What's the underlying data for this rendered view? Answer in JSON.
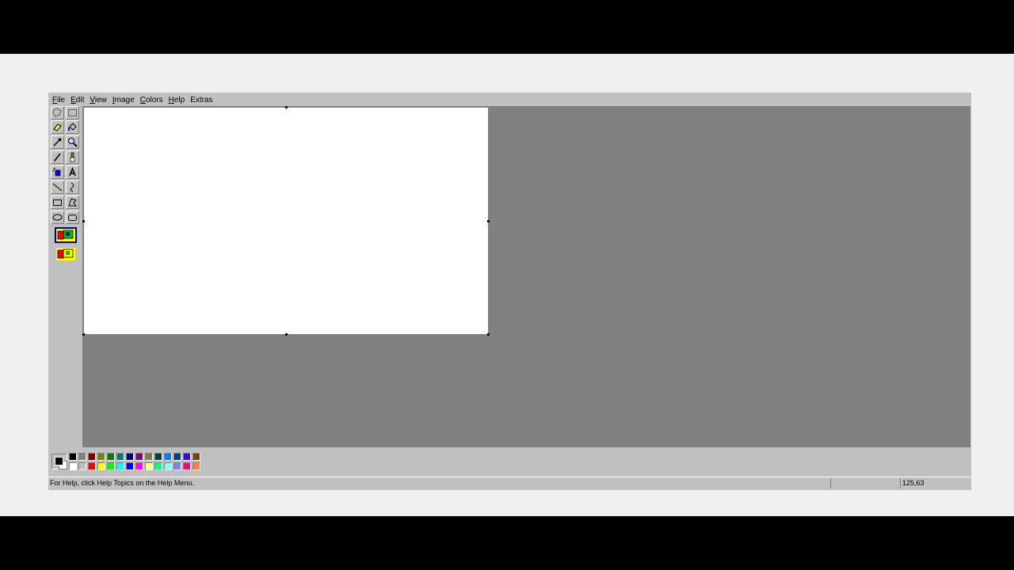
{
  "menu": [
    {
      "label": "File",
      "underline": "F",
      "rest": "ile"
    },
    {
      "label": "Edit",
      "underline": "E",
      "rest": "dit"
    },
    {
      "label": "View",
      "underline": "V",
      "rest": "iew"
    },
    {
      "label": "Image",
      "underline": "I",
      "rest": "mage"
    },
    {
      "label": "Colors",
      "underline": "C",
      "rest": "olors"
    },
    {
      "label": "Help",
      "underline": "H",
      "rest": "elp"
    },
    {
      "label": "Extras",
      "underline": "",
      "rest": "Extras"
    }
  ],
  "tools": [
    "free-select-icon",
    "rect-select-icon",
    "eraser-icon",
    "fill-bucket-icon",
    "color-picker-icon",
    "magnifier-icon",
    "pencil-icon",
    "brush-icon",
    "airbrush-icon",
    "text-icon",
    "line-icon",
    "curve-icon",
    "rectangle-icon",
    "polygon-icon",
    "ellipse-icon",
    "rounded-rect-icon"
  ],
  "palette": {
    "foreground": "#000000",
    "background": "#ffffff",
    "top_row": [
      "#000000",
      "#808080",
      "#800000",
      "#808000",
      "#008000",
      "#008080",
      "#000080",
      "#800080",
      "#808040",
      "#004040",
      "#0080ff",
      "#004080",
      "#4000ff",
      "#804000"
    ],
    "bottom_row": [
      "#ffffff",
      "#c0c0c0",
      "#ff0000",
      "#ffff00",
      "#00ff00",
      "#00ffff",
      "#0000ff",
      "#ff00ff",
      "#ffff80",
      "#00ff80",
      "#80ffff",
      "#8080ff",
      "#ff0080",
      "#ff8040"
    ]
  },
  "status": {
    "help_text": "For Help, click Help Topics on the Help Menu.",
    "coordinates": "125,63"
  }
}
